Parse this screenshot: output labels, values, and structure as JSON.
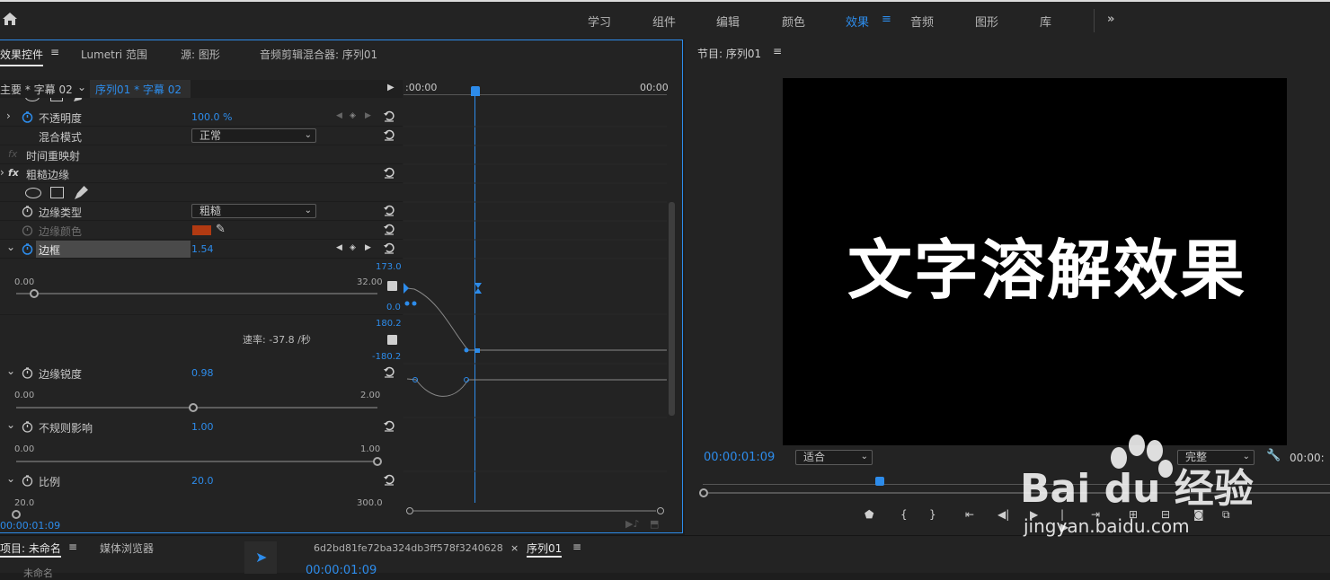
{
  "workspace_tabs": [
    "学习",
    "组件",
    "编辑",
    "颜色",
    "效果",
    "音频",
    "图形",
    "库"
  ],
  "workspace_active": "效果",
  "more_label": "»",
  "ec_tabs": {
    "effect_controls": "效果控件",
    "lumetri": "Lumetri 范围",
    "source": "源: 图形",
    "audio_mixer": "音频剪辑混合器: 序列01"
  },
  "clip_selector": {
    "master": "主要 * 字幕 02",
    "sequence": "序列01 * 字幕 02"
  },
  "timeline": {
    "start": ":00:00",
    "end": "00:00"
  },
  "rows": {
    "opacity": {
      "label": "不透明度",
      "value": "100.0 %"
    },
    "blend": {
      "label": "混合模式",
      "value": "正常"
    },
    "time_remap": {
      "label": "时间重映射"
    },
    "rough_edges": {
      "label": "粗糙边缘"
    },
    "edge_type": {
      "label": "边缘类型",
      "value": "粗糙"
    },
    "edge_color": {
      "label": "边缘颜色"
    },
    "border": {
      "label": "边框",
      "value": "1.54",
      "min": "0.00",
      "max": "32.00",
      "graph_max": "173.0",
      "graph_zero": "0.0",
      "vel_max": "180.2",
      "vel_min": "-180.2",
      "velocity": "速率: -37.8 /秒"
    },
    "sharpness": {
      "label": "边缘锐度",
      "value": "0.98",
      "min": "0.00",
      "max": "2.00"
    },
    "irregular": {
      "label": "不规则影响",
      "value": "1.00",
      "min": "0.00",
      "max": "1.00"
    },
    "scale": {
      "label": "比例",
      "value": "20.0",
      "min": "20.0",
      "max": "300.0"
    }
  },
  "slider_levels": {
    "border": 0.05,
    "sharpness": 0.49,
    "irregular": 1.0,
    "scale": 0.0
  },
  "ec_timecode": "00:00:01:09",
  "program": {
    "title": "节目: 序列01",
    "overlay_text": "文字溶解效果",
    "timecode": "00:00:01:09",
    "fit": "适合",
    "quality": "完整",
    "end_timecode": "00:00:"
  },
  "bottom": {
    "project": "项目: 未命名",
    "media_browser": "媒体浏览器",
    "project_sub": "未命名",
    "file_tab": "6d2bd81fe72ba324db3ff578f3240628",
    "seq_tab": "序列01",
    "seq_timecode": "00:00:01:09"
  },
  "watermark": {
    "logo": "Bai du 经验",
    "url": "jingyan.baidu.com"
  },
  "colors": {
    "accent": "#2d8ceb",
    "edge_color": "#b13a12",
    "panel": "#232323"
  }
}
